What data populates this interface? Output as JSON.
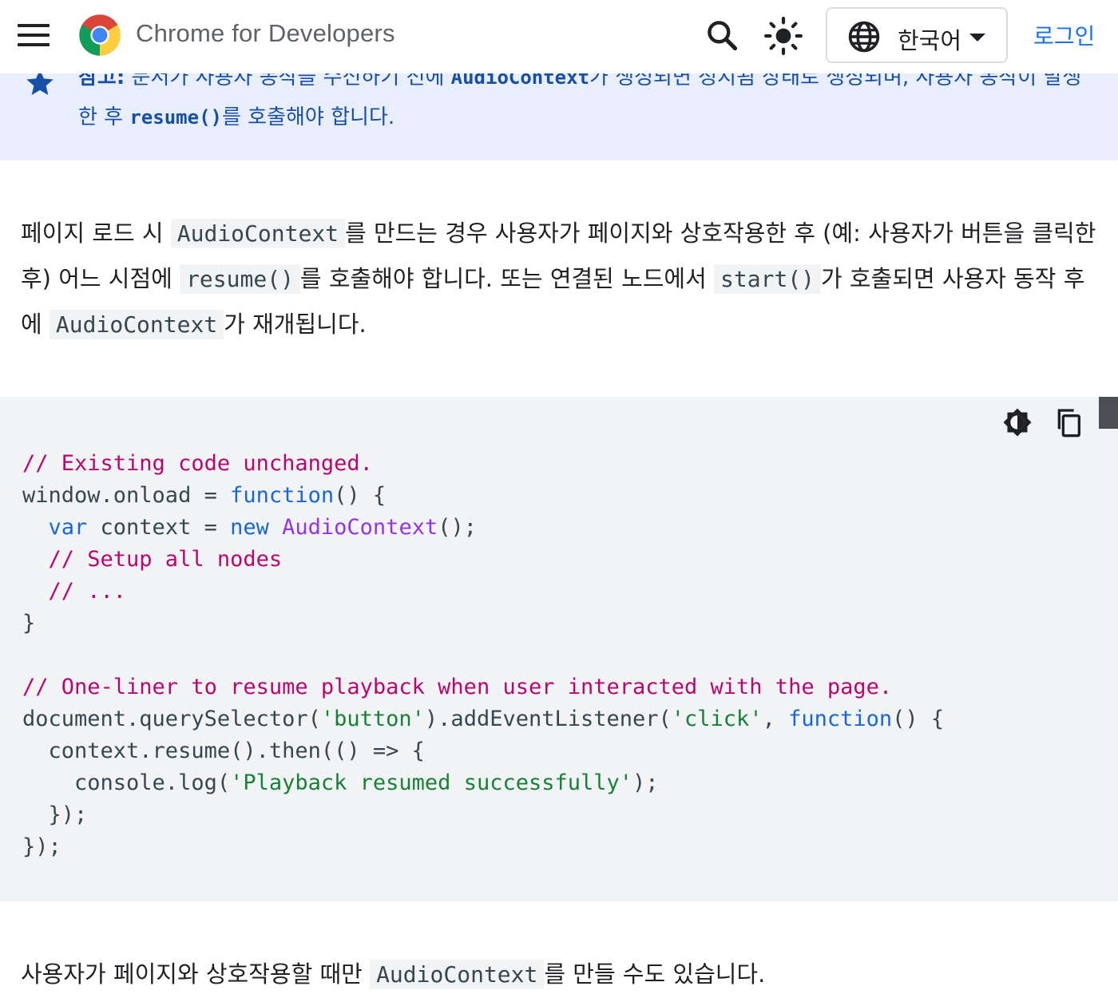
{
  "header": {
    "site_title": "Chrome for Developers",
    "language": "한국어",
    "login": "로그인"
  },
  "note": {
    "line1_label": "참고:",
    "line1_text_a": " 문서가 사용자 동작을 수신하기 전에 ",
    "line1_code": "AudioContext",
    "line1_text_b": "가 생성되면 정지됨 상태로 생성되며, 사용자 동작이 발생",
    "line2_text_a": "한 후 ",
    "line2_code": "resume()",
    "line2_text_b": "를 호출해야 합니다."
  },
  "para1": {
    "t1": "페이지 로드 시 ",
    "c1": "AudioContext",
    "t2": "를 만드는 경우 사용자가 페이지와 상호작용한 후 (예: 사용자가 버튼을 클릭한 후) 어느 시점에 ",
    "c2": "resume()",
    "t3": "를 호출해야 합니다. 또는 연결된 노드에서 ",
    "c3": "start()",
    "t4": "가 호출되면 사용자 동작 후에 ",
    "c4": "AudioContext",
    "t5": "가 재개됩니다."
  },
  "code": {
    "l1_cm": "// Existing code unchanged.",
    "l2_a": "window.onload = ",
    "l2_kw": "function",
    "l2_b": "() {",
    "l3_kw1": "  var",
    "l3_a": " context = ",
    "l3_kw2": "new",
    "l3_sp": " ",
    "l3_cls": "AudioContext",
    "l3_b": "();",
    "l4_cm": "  // Setup all nodes",
    "l5_cm": "  // ...",
    "l6": "}",
    "l8_cm": "// One-liner to resume playback when user interacted with the page.",
    "l9_a": "document.querySelector(",
    "l9_str1": "'button'",
    "l9_b": ").addEventListener(",
    "l9_str2": "'click'",
    "l9_c": ", ",
    "l9_kw": "function",
    "l9_d": "() {",
    "l10": "  context.resume().then(() => {",
    "l11_a": "    console.log(",
    "l11_str": "'Playback resumed successfully'",
    "l11_b": ");",
    "l12": "  });",
    "l13": "});"
  },
  "para2": {
    "t1": "사용자가 페이지와 상호작용할 때만 ",
    "c1": "AudioContext",
    "t2": "를 만들 수도 있습니다."
  },
  "icons": {
    "menu": "hamburger-menu-icon",
    "search": "search-icon",
    "theme": "sun-icon",
    "language": "globe-icon",
    "note": "star-icon",
    "contrast": "contrast-icon",
    "copy": "copy-icon"
  },
  "colors": {
    "accent": "#1a73e8",
    "note_bg": "#e8eefc",
    "code_bg": "#f1f3f4",
    "comment": "#b80672",
    "keyword": "#1967d2",
    "string": "#188038",
    "class": "#9334e6"
  }
}
